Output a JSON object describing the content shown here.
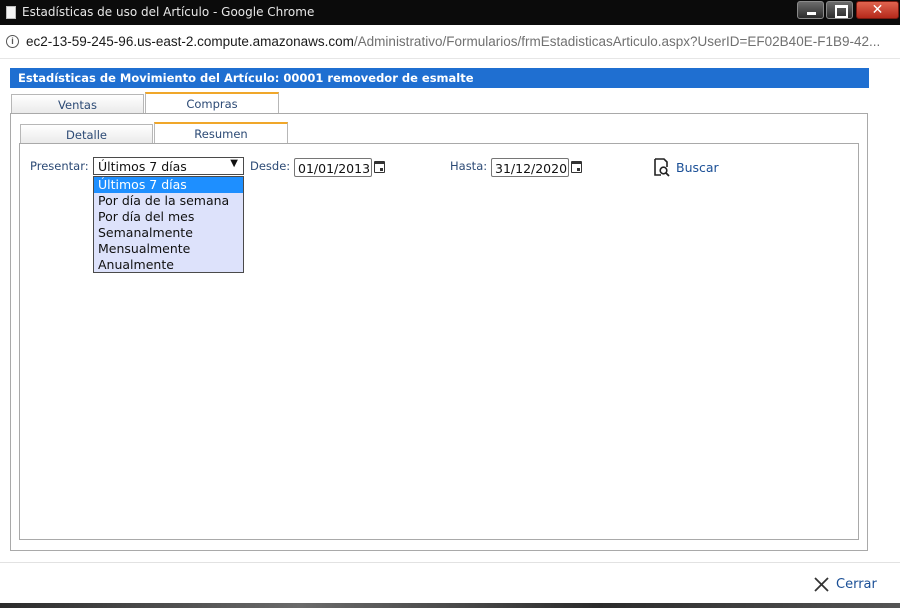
{
  "window": {
    "title": "Estadísticas de uso del Artículo - Google Chrome",
    "close_glyph": "✕"
  },
  "address": {
    "info_glyph": "i",
    "host": "ec2-13-59-245-96.us-east-2.compute.amazonaws.com",
    "path": "/Administrativo/Formularios/frmEstadisticasArticulo.aspx?UserID=EF02B40E-F1B9-42..."
  },
  "header": {
    "title": "Estadísticas de Movimiento del Artículo: 00001 removedor de esmalte",
    "color": "#1f6fd1"
  },
  "outer_tabs": [
    {
      "label": "Ventas",
      "active": false
    },
    {
      "label": "Compras",
      "active": true
    }
  ],
  "inner_tabs": [
    {
      "label": "Detalle",
      "active": false
    },
    {
      "label": "Resumen",
      "active": true
    }
  ],
  "filters": {
    "presentar_label": "Presentar:",
    "presentar_value": "Últimos 7 días",
    "presentar_arrow": "▼",
    "desde_label": "Desde:",
    "desde_value": "01/01/2013",
    "hasta_label": "Hasta:",
    "hasta_value": "31/12/2020",
    "buscar_label": "Buscar"
  },
  "dropdown_options": [
    {
      "label": "Últimos 7 días",
      "selected": true
    },
    {
      "label": "Por día de la semana",
      "selected": false
    },
    {
      "label": "Por día del mes",
      "selected": false
    },
    {
      "label": "Semanalmente",
      "selected": false
    },
    {
      "label": "Mensualmente",
      "selected": false
    },
    {
      "label": "Anualmente",
      "selected": false
    }
  ],
  "footer": {
    "cerrar_label": "Cerrar"
  },
  "icons": {
    "calendar": "calendar-icon",
    "search": "search-document-icon",
    "close": "close-icon",
    "info": "info-icon"
  },
  "colors": {
    "accent_tab": "#f0a72a",
    "dropdown_selected": "#1e8fff",
    "dropdown_bg": "#dde2fb",
    "link": "#1a4f96"
  }
}
